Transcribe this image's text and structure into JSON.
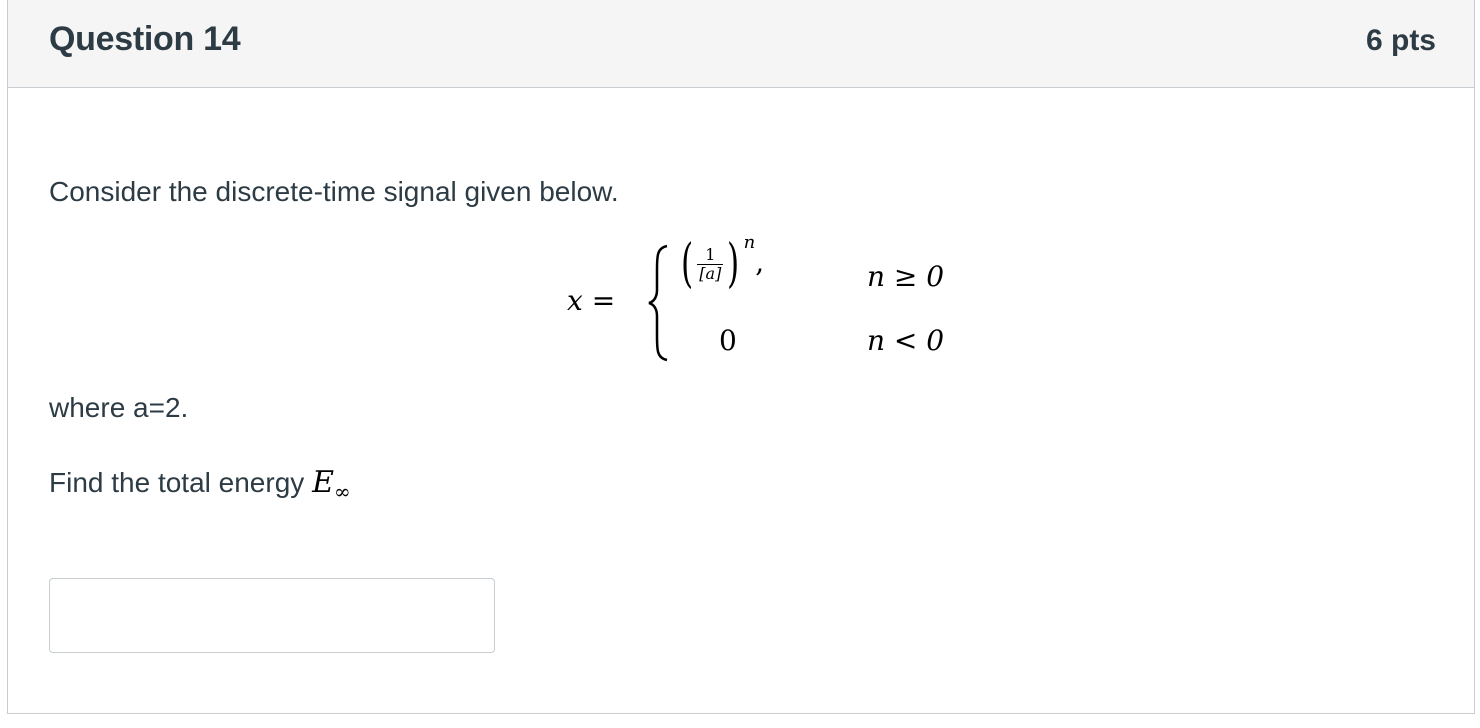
{
  "question": {
    "title": "Question 14",
    "points": "6 pts"
  },
  "body": {
    "intro": "Consider the discrete-time signal given below.",
    "where_text": "where a=2.",
    "find_text": "Find the total energy",
    "energy_symbol": "E",
    "energy_subscript": "∞"
  },
  "equation": {
    "lhs": "x =",
    "case1_numerator": "1",
    "case1_denominator": "[a]",
    "case1_exponent": "n",
    "case1_condition": "n ≥ 0",
    "case2_value": "0",
    "case2_condition": "n < 0"
  },
  "answer": {
    "value": "",
    "placeholder": ""
  },
  "colors": {
    "header_bg": "#f5f5f5",
    "border": "#c7cdd1",
    "text": "#2d3b45"
  }
}
